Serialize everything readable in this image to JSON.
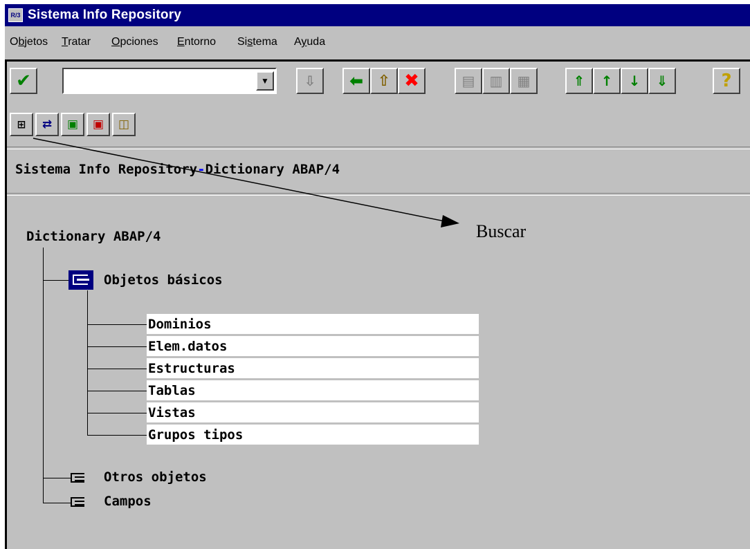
{
  "window": {
    "title": "Sistema Info Repository",
    "icon_text": "R/3"
  },
  "menu": [
    {
      "pre": "O",
      "ul": "b",
      "post": "jetos"
    },
    {
      "pre": "",
      "ul": "T",
      "post": "ratar"
    },
    {
      "pre": "",
      "ul": "O",
      "post": "pciones"
    },
    {
      "pre": "",
      "ul": "E",
      "post": "ntorno"
    },
    {
      "pre": "Si",
      "ul": "s",
      "post": "tema"
    },
    {
      "pre": "A",
      "ul": "y",
      "post": "uda"
    }
  ],
  "toolbar": {
    "command_value": "",
    "icons": {
      "enter": "check-icon",
      "save": "save-icon",
      "back": "back-arrow-icon",
      "up": "up-arrow-icon",
      "cancel": "cancel-icon",
      "print": "print-icon",
      "find": "find-icon",
      "find_next": "find-next-icon",
      "first_page": "first-page-icon",
      "prev_page": "previous-page-icon",
      "next_page": "next-page-icon",
      "last_page": "last-page-icon",
      "help": "help-icon"
    }
  },
  "app_toolbar": {
    "icons": [
      "binoculars-icon",
      "hierarchy-icon",
      "expand-icon",
      "collapse-icon",
      "select-icon"
    ]
  },
  "page": {
    "title_part1": "Sistema Info Repository",
    "title_sep": "-",
    "title_part2": "Dictionary ABAP/4"
  },
  "tree": {
    "root": "Dictionary ABAP/4",
    "open_node": "Objetos básicos",
    "leaves": [
      "Dominios",
      "Elem.datos",
      "Estructuras",
      "Tablas",
      "Vistas",
      "Grupos tipos"
    ],
    "closed_nodes": [
      "Otros objetos",
      "Campos"
    ]
  },
  "annotation": {
    "label": "Buscar"
  },
  "colors": {
    "titlebar": "#000080",
    "face": "#c0c0c0",
    "highlight": "#0000ff",
    "check": "#008000",
    "cancel": "#ff0000",
    "help": "#ffff00"
  }
}
